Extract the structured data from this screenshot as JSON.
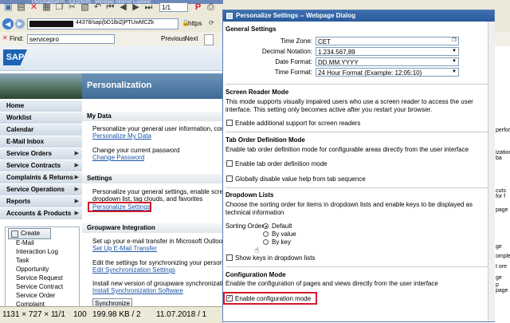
{
  "browser": {
    "page_field": "1/1",
    "window_title": "Personalization - [QU2/500] - Windows Internet Explorer",
    "address": "44378/sap(bD1lbiZjPTUwMCZk",
    "https_label": "https",
    "find_label": "Find:",
    "find_value": "servicepro",
    "find_prev": "Previous",
    "find_next": "Next"
  },
  "sap": {
    "logo": "SAP",
    "page_title": "Personalization",
    "nav": [
      {
        "label": "Home",
        "arrow": false
      },
      {
        "label": "Worklist",
        "arrow": false
      },
      {
        "label": "Calendar",
        "arrow": false
      },
      {
        "label": "E-Mail Inbox",
        "arrow": false
      },
      {
        "label": "Service Orders",
        "arrow": true
      },
      {
        "label": "Service Contracts",
        "arrow": true
      },
      {
        "label": "Complaints & Returns",
        "arrow": true
      },
      {
        "label": "Service Operations",
        "arrow": true
      },
      {
        "label": "Reports",
        "arrow": true
      },
      {
        "label": "Accounts & Products",
        "arrow": true
      }
    ],
    "create": {
      "label": "Create",
      "items": [
        "E-Mail",
        "Interaction Log",
        "Task",
        "Opportunity",
        "Service Request",
        "Service Contract",
        "Service Order",
        "Complaint"
      ]
    },
    "my_data": {
      "title": "My Data",
      "desc": "Personalize your general user information, comm",
      "link1": "Personalize My Data",
      "desc2": "Change your current password",
      "link2": "Change Password"
    },
    "settings": {
      "title": "Settings",
      "desc_lines": [
        "Personalize your general settings, enable scree",
        "dropdown list, tag clouds, and favorites"
      ],
      "link": "Personalize Settings"
    },
    "groupware": {
      "title": "Groupware Integration",
      "desc1": "Set up your e-mail transfer in Microsoft Outlook",
      "link1": "Set Up E-Mail Transfer",
      "desc2": "Edit the settings for synchronizing your persona",
      "link2": "Edit Synchronization Settings",
      "desc3": "Install new version of groupware synchronizati",
      "link3": "Install Synchronization Software",
      "button": "Synchronize"
    },
    "right_snippets": [
      "performa",
      "ization ba",
      "cuts for f",
      "page",
      "ge",
      "ompleme",
      "t ore",
      "ge",
      "p page"
    ]
  },
  "status": {
    "dims": "1131 × 727 × 1",
    "c2": "1/1",
    "c3": "100",
    "size": "199.98 KB / 2",
    "date": "11.07.2018 / 1"
  },
  "dialog": {
    "title": "Personalize Settings -- Webpage Dialog",
    "general": {
      "title": "General Settings",
      "fields": [
        {
          "label": "Time Zone:",
          "value": "CET"
        },
        {
          "label": "Decimal Notation:",
          "value": "1.234.567,89"
        },
        {
          "label": "Date Format:",
          "value": "DD.MM.YYYY"
        },
        {
          "label": "Time Format:",
          "value": "24 Hour Format (Example: 12:05:10)"
        }
      ]
    },
    "screen_reader": {
      "title": "Screen Reader Mode",
      "desc": "This mode supports visually impaired users who use a screen reader to access the user interface. This setting only becomes active after you restart your browser.",
      "checkbox": "Enable additional support for screen readers"
    },
    "tab_order": {
      "title": "Tab Order Definition Mode",
      "desc": "Enable tab order definition mode for configurable areas directly from the user interface",
      "checkbox1": "Enable tab order definition mode",
      "checkbox2": "Globally disable value help from tab sequence"
    },
    "dropdown": {
      "title": "Dropdown Lists",
      "desc": "Choose the sorting order for items in dropdown lists and enable keys to be displayed as technical information",
      "sort_label": "Sorting Order",
      "options": [
        "Default",
        "By value",
        "By key"
      ],
      "checkbox": "Show keys in dropdown lists"
    },
    "config": {
      "title": "Configuration Mode",
      "desc": "Enable the configuration of pages and views directly from the user interface",
      "checkbox": "Enable configuration mode",
      "check_mark": "✓"
    }
  },
  "colors": {
    "highlight": "#d21a2a",
    "link": "#1a55a8",
    "dialog_title": "#2a5a9c"
  }
}
